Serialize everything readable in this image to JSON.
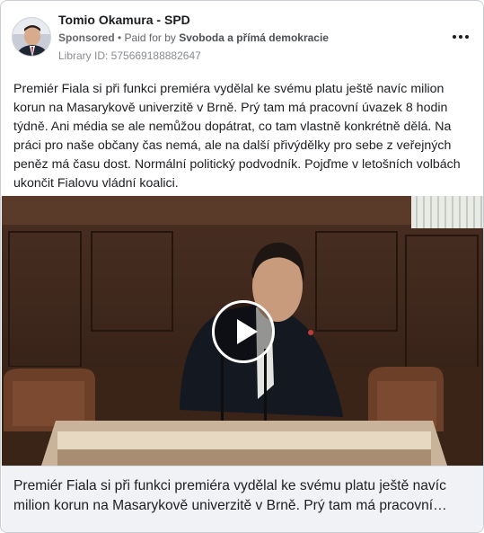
{
  "ad": {
    "page_name": "Tomio Okamura - SPD",
    "sponsored_label": "Sponsored",
    "separator": " • ",
    "paid_for_by_label": "Paid for by ",
    "payer": "Svoboda a přímá demokracie",
    "library_id": "Library ID: 575669188882647",
    "more_icon": "more-horizontal-icon"
  },
  "post": {
    "text": "Premiér Fiala si při funkci premiéra vydělal ke svému platu ještě navíc milion korun na Masarykově univerzitě v Brně. Prý tam má pracovní úvazek 8 hodin týdně. Ani média se ale nemůžou dopátrat, co tam vlastně konkrétně dělá. Na práci pro naše občany čas nemá, ale na další přivýdělky pro sebe z veřejných peněz má času dost. Normální politický podvodník. Pojďme v letošních volbách ukončit Fialovu vládní koalici."
  },
  "video": {
    "play_icon": "play-icon"
  },
  "footer": {
    "caption": "Premiér Fiala si při funkci premiéra vydělal ke svému platu ještě navíc milion korun na Masarykově univerzitě v Brně. Prý tam má pracovní úvazek 8 hodin týdně. Ani média se ale nemůžou dopátrat, co tam vlastně konkrétně dělá."
  },
  "colors": {
    "text": "#1c1e21",
    "secondary_text": "#65676b",
    "footer_bg": "#f0f2f5",
    "card_border": "#c9ccd1"
  }
}
